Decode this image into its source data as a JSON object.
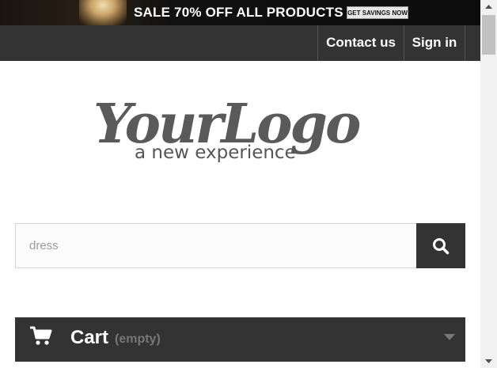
{
  "promo": {
    "text": "SALE 70% OFF ALL PRODUCTS",
    "button_label": "GET SAVINGS NOW"
  },
  "nav": {
    "contact_label": "Contact us",
    "signin_label": "Sign in"
  },
  "logo": {
    "main": "YourLogo",
    "tagline": "a new experience"
  },
  "search": {
    "value": "dress",
    "icon": "search-icon"
  },
  "cart": {
    "label": "Cart",
    "status": "(empty)",
    "icon": "shopping-cart-icon"
  },
  "colors": {
    "dark_bar": "#333333",
    "accent_gray": "#777777"
  }
}
